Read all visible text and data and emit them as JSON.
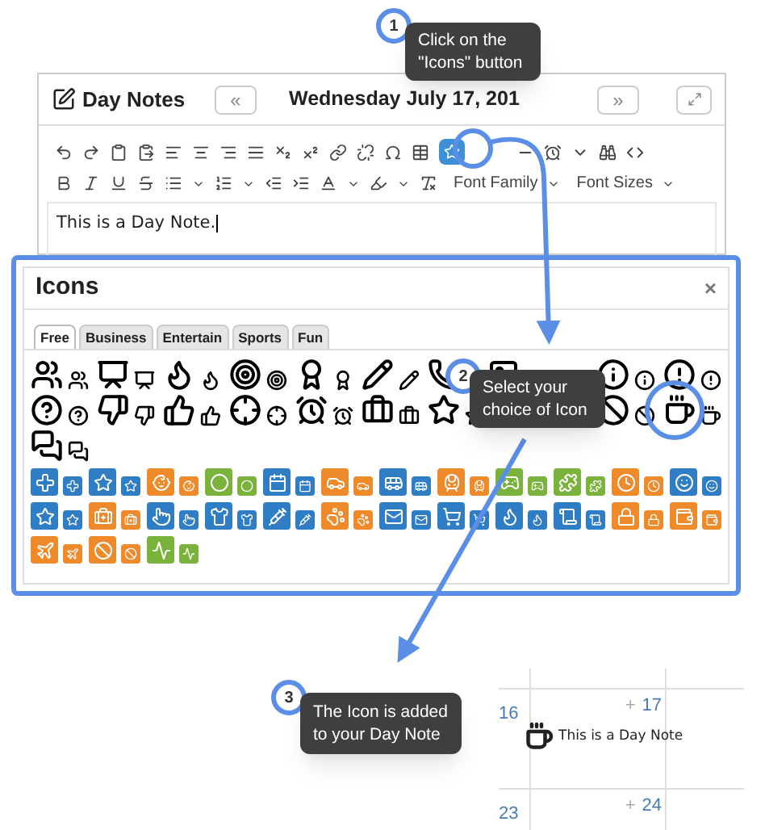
{
  "editor": {
    "title": "Day Notes",
    "prev_button": "«",
    "date": "Wednesday July 17, 201",
    "next_button": "»",
    "font_family": "Font Family",
    "font_sizes": "Font Sizes",
    "note_text": "This is a Day Note."
  },
  "icons_dialog": {
    "title": "Icons",
    "close": "×",
    "tabs": [
      {
        "label": "Free",
        "selected": true
      },
      {
        "label": "Business",
        "selected": false
      },
      {
        "label": "Entertain",
        "selected": false
      },
      {
        "label": "Sports",
        "selected": false
      },
      {
        "label": "Fun",
        "selected": false
      }
    ],
    "tile_rows": [
      [
        {
          "color": "#2f7dc4"
        },
        {
          "color": "#2f7dc4"
        },
        {
          "color": "#ef8a2b"
        },
        {
          "color": "#7ab33c"
        },
        {
          "color": "#2f7dc4"
        },
        {
          "color": "#ef8a2b"
        },
        {
          "color": "#2f7dc4"
        },
        {
          "color": "#ef8a2b"
        },
        {
          "color": "#7ab33c"
        },
        {
          "color": "#7ab33c"
        },
        {
          "color": "#ef8a2b"
        },
        {
          "color": "#2f7dc4"
        }
      ],
      [
        {
          "color": "#2f7dc4"
        },
        {
          "color": "#ef8a2b"
        },
        {
          "color": "#2f7dc4"
        },
        {
          "color": "#2f7dc4"
        },
        {
          "color": "#2f7dc4"
        },
        {
          "color": "#ef8a2b"
        },
        {
          "color": "#2f7dc4"
        },
        {
          "color": "#2f7dc4"
        },
        {
          "color": "#2f7dc4"
        },
        {
          "color": "#2f7dc4"
        },
        {
          "color": "#ef8a2b"
        },
        {
          "color": "#ef8a2b"
        }
      ],
      [
        {
          "color": "#ef8a2b"
        },
        {
          "color": "#ef8a2b"
        },
        {
          "color": "#7ab33c"
        }
      ]
    ]
  },
  "calendar": {
    "rows": [
      {
        "cells": [
          {
            "day": "16"
          },
          {
            "day": "17",
            "add": "+"
          }
        ],
        "note": "This is a Day Note"
      },
      {
        "cells": [
          {
            "day": "23"
          },
          {
            "day": "24",
            "add": "+"
          }
        ]
      }
    ]
  },
  "callouts": [
    {
      "number": "1",
      "text": "Click on the \"Icons\" button"
    },
    {
      "number": "2",
      "text": "Select your choice of Icon"
    },
    {
      "number": "3",
      "text": "The Icon is added to your Day Note"
    }
  ]
}
